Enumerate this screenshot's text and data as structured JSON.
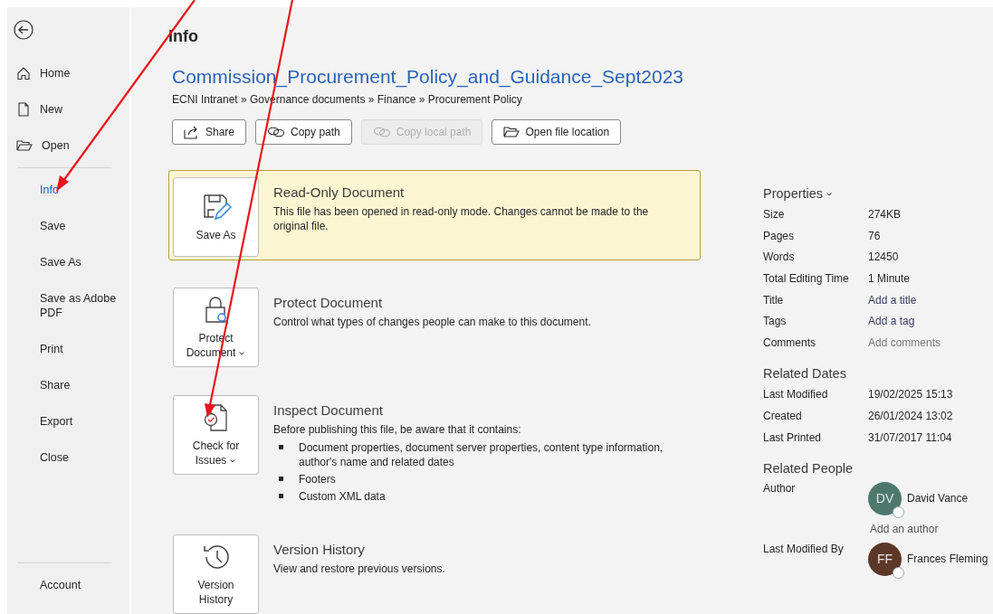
{
  "sidebar": {
    "top_items": [
      {
        "label": "Home",
        "selected": false
      },
      {
        "label": "New",
        "selected": false
      },
      {
        "label": "Open",
        "selected": false
      }
    ],
    "items": [
      {
        "label": "Info",
        "selected": true
      },
      {
        "label": "Save",
        "selected": false
      },
      {
        "label": "Save As",
        "selected": false
      },
      {
        "label": "Save as Adobe PDF",
        "selected": false
      },
      {
        "label": "Print",
        "selected": false
      },
      {
        "label": "Share",
        "selected": false
      },
      {
        "label": "Export",
        "selected": false
      },
      {
        "label": "Close",
        "selected": false
      }
    ],
    "bottom_items": [
      {
        "label": "Account",
        "selected": false
      }
    ]
  },
  "page_title": "Info",
  "document": {
    "title": "Commission_Procurement_Policy_and_Guidance_Sept2023",
    "breadcrumb": "ECNI Intranet » Governance documents » Finance » Procurement Policy"
  },
  "actions": [
    {
      "label": "Share",
      "disabled": false
    },
    {
      "label": "Copy path",
      "disabled": false
    },
    {
      "label": "Copy local path",
      "disabled": true
    },
    {
      "label": "Open file location",
      "disabled": false
    }
  ],
  "sections": [
    {
      "button": "Save As",
      "has_menu": false,
      "highlighted": true,
      "title": "Read-Only Document",
      "description": "This file has been opened in read-only mode. Changes cannot be made to the original file."
    },
    {
      "button": "Protect Document",
      "has_menu": true,
      "highlighted": false,
      "title": "Protect Document",
      "description": "Control what types of changes people can make to this document."
    },
    {
      "button": "Check for Issues",
      "has_menu": true,
      "highlighted": false,
      "title": "Inspect Document",
      "description": "Before publishing this file, be aware that it contains:",
      "bullets": [
        "Document properties, document server properties, content type information, author's name and related dates",
        "Footers",
        "Custom XML data"
      ]
    },
    {
      "button": "Version History",
      "has_menu": false,
      "highlighted": false,
      "title": "Version History",
      "description": "View and restore previous versions."
    }
  ],
  "properties": {
    "heading": "Properties",
    "rows": [
      {
        "label": "Size",
        "value": "274KB",
        "kind": "value"
      },
      {
        "label": "Pages",
        "value": "76",
        "kind": "value"
      },
      {
        "label": "Words",
        "value": "12450",
        "kind": "value"
      },
      {
        "label": "Total Editing Time",
        "value": "1 Minute",
        "kind": "value"
      },
      {
        "label": "Title",
        "value": "Add a title",
        "kind": "prompt"
      },
      {
        "label": "Tags",
        "value": "Add a tag",
        "kind": "prompt"
      },
      {
        "label": "Comments",
        "placeholder": "Add comments",
        "kind": "field"
      }
    ]
  },
  "related_dates": {
    "heading": "Related Dates",
    "rows": [
      {
        "label": "Last Modified",
        "value": "19/02/2025 15:13"
      },
      {
        "label": "Created",
        "value": "26/01/2024 13:02"
      },
      {
        "label": "Last Printed",
        "value": "31/07/2017 11:04"
      }
    ]
  },
  "related_people": {
    "heading": "Related People",
    "author": {
      "label": "Author",
      "initials": "DV",
      "name": "David Vance",
      "color": "#4e786c",
      "add_link": "Add an author"
    },
    "last_modified_by": {
      "label": "Last Modified By",
      "initials": "FF",
      "name": "Frances Fleming",
      "color": "#5c3829"
    }
  }
}
